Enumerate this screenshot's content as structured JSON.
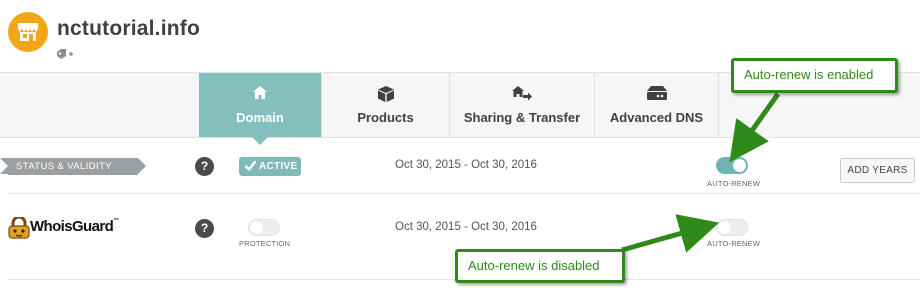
{
  "site": {
    "title": "nctutorial.info",
    "logo_icon": "storefront-icon",
    "tag_icon": "tag-add-icon"
  },
  "tabs": [
    {
      "label": "Domain",
      "icon": "home-icon",
      "active": true
    },
    {
      "label": "Products",
      "icon": "box-icon",
      "active": false
    },
    {
      "label": "Sharing & Transfer",
      "icon": "share-transfer-icon",
      "active": false
    },
    {
      "label": "Advanced DNS",
      "icon": "dns-icon",
      "active": false
    }
  ],
  "status_row": {
    "label": "STATUS & VALIDITY",
    "help": "?",
    "badge": "ACTIVE",
    "dates": "Oct 30, 2015 - Oct 30, 2016",
    "autorenew_caption": "AUTO-RENEW",
    "autorenew_on": true,
    "add_years": "ADD YEARS"
  },
  "whois_row": {
    "brand": "WhoisGuard",
    "brand_tm": "™",
    "help": "?",
    "protection_caption": "PROTECTION",
    "protection_on": false,
    "dates": "Oct 30, 2015 - Oct 30, 2016",
    "autorenew_caption": "AUTO-RENEW",
    "autorenew_on": false
  },
  "annotations": {
    "enabled": "Auto-renew is enabled",
    "disabled": "Auto-renew is disabled"
  },
  "colors": {
    "accent": "#84bfbd",
    "toggle_on": "#6fb4b2",
    "logo": "#f2a71a",
    "callout": "#2f8a19"
  }
}
